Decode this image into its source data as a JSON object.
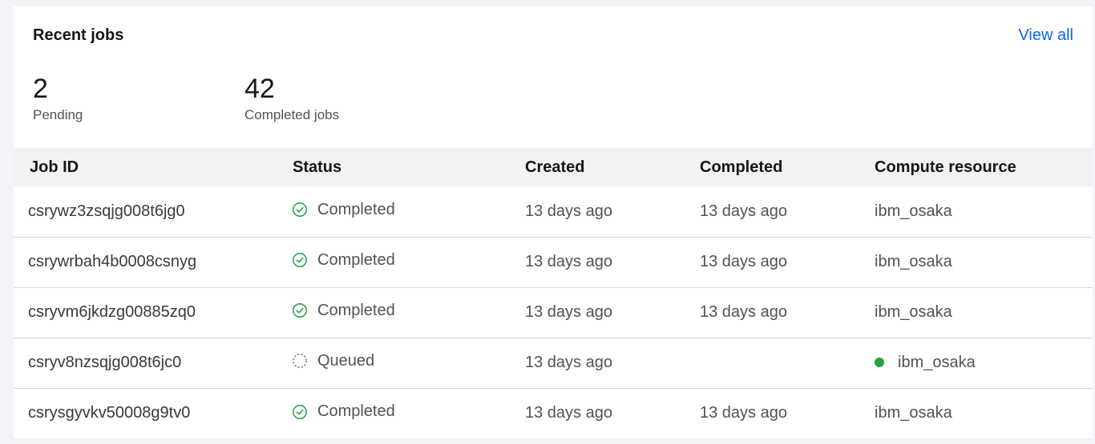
{
  "card": {
    "title": "Recent jobs",
    "view_all_label": "View all"
  },
  "stats": {
    "pending": {
      "value": "2",
      "label": "Pending"
    },
    "completed": {
      "value": "42",
      "label": "Completed jobs"
    }
  },
  "table": {
    "columns": [
      "Job ID",
      "Status",
      "Created",
      "Completed",
      "Compute resource"
    ],
    "rows": [
      {
        "job_id": "csrywz3zsqjg008t6jg0",
        "status": "Completed",
        "status_icon": "checkmark-outline-icon",
        "created": "13 days ago",
        "completed": "13 days ago",
        "resource": "ibm_osaka",
        "resource_indicator": false
      },
      {
        "job_id": "csrywrbah4b0008csnyg",
        "status": "Completed",
        "status_icon": "checkmark-outline-icon",
        "created": "13 days ago",
        "completed": "13 days ago",
        "resource": "ibm_osaka",
        "resource_indicator": false
      },
      {
        "job_id": "csryvm6jkdzg00885zq0",
        "status": "Completed",
        "status_icon": "checkmark-outline-icon",
        "created": "13 days ago",
        "completed": "13 days ago",
        "resource": "ibm_osaka",
        "resource_indicator": false
      },
      {
        "job_id": "csryv8nzsqjg008t6jc0",
        "status": "Queued",
        "status_icon": "queued-dashed-circle-icon",
        "created": "13 days ago",
        "completed": "",
        "resource": "ibm_osaka",
        "resource_indicator": true
      },
      {
        "job_id": "csrysgyvkv50008g9tv0",
        "status": "Completed",
        "status_icon": "checkmark-outline-icon",
        "created": "13 days ago",
        "completed": "13 days ago",
        "resource": "ibm_osaka",
        "resource_indicator": false
      }
    ]
  },
  "colors": {
    "accent_link": "#0f62fe",
    "success": "#24a148",
    "header_bg": "#f2f2f2",
    "page_bg": "#f2f4f8"
  }
}
